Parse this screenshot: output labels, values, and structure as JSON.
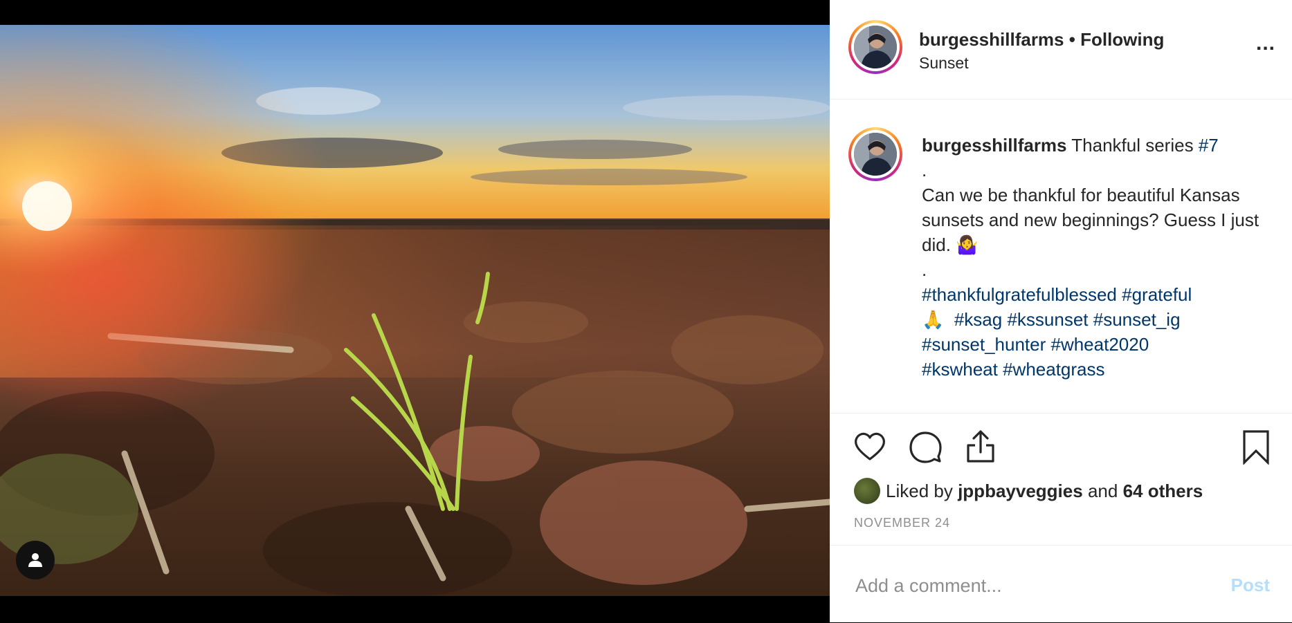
{
  "post": {
    "username": "burgesshillfarms",
    "separator": "•",
    "follow_status": "Following",
    "location": "Sunset",
    "more_label": "...",
    "caption": {
      "username": "burgesshillfarms",
      "title": "Thankful series",
      "title_tag": "#7",
      "dot1": ".",
      "body": "Can we be thankful for beautiful Kansas sunsets and new beginnings? Guess I just did.",
      "emoji": "🤷‍♀️",
      "dot2": ".",
      "tags_line1": [
        "#thankfulgratefulblessed",
        "#grateful"
      ],
      "pray_emoji": "🙏",
      "tags_line2": [
        "#ksag",
        "#kssunset",
        "#sunset_ig"
      ],
      "tags_line3": [
        "#sunset_hunter",
        "#wheat2020"
      ],
      "tags_line4": [
        "#kswheat",
        "#wheatgrass"
      ]
    },
    "likes": {
      "prefix": "Liked by",
      "liker": "jppbayveggies",
      "conjunction": "and",
      "others": "64 others"
    },
    "date": "NOVEMBER 24",
    "comment": {
      "placeholder": "Add a comment...",
      "post_label": "Post"
    }
  },
  "icons": {
    "like": "heart-icon",
    "comment": "comment-icon",
    "share": "share-icon",
    "save": "bookmark-icon",
    "user_tag": "person-icon",
    "more": "more-options-icon"
  },
  "colors": {
    "hashtag": "#00376b",
    "post_disabled": "#b2dffc",
    "muted": "#8e8e8e"
  }
}
